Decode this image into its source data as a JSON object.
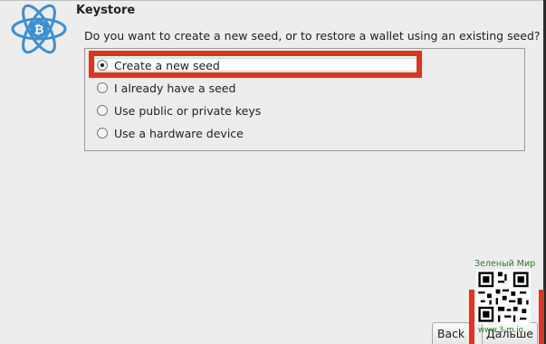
{
  "dialog": {
    "title": "Keystore",
    "question": "Do you want to create a new seed, or to restore a wallet using an existing seed?",
    "options": [
      {
        "label": "Create a new seed",
        "selected": true
      },
      {
        "label": "I already have a seed",
        "selected": false
      },
      {
        "label": "Use public or private keys",
        "selected": false
      },
      {
        "label": "Use a hardware device",
        "selected": false
      }
    ]
  },
  "buttons": {
    "back_label": "Back",
    "next_label": "Дальше"
  },
  "watermark": {
    "title": "Зеленый Мир",
    "url": "www.3-m.io"
  },
  "colors": {
    "highlight": "#d23a26",
    "logo": "#3d8fd1",
    "watermark_text": "#2d7a2a"
  },
  "icons": {
    "logo": "electrum-atom-bitcoin-icon"
  }
}
